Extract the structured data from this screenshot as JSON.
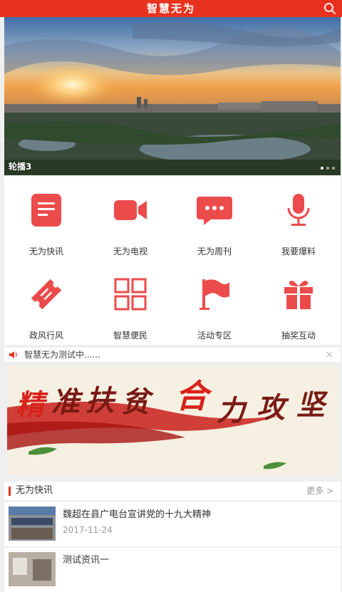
{
  "header": {
    "title": "智慧无为",
    "search_icon": "search-icon"
  },
  "banner": {
    "caption": "轮播3",
    "total_slides": 3,
    "active_slide": 1
  },
  "menu": [
    {
      "label": "无为快讯",
      "icon": "document-icon"
    },
    {
      "label": "无为电视",
      "icon": "video-camera-icon"
    },
    {
      "label": "无为周刊",
      "icon": "chat-bubble-icon"
    },
    {
      "label": "我要爆料",
      "icon": "microphone-icon"
    },
    {
      "label": "政风行风",
      "icon": "ticket-icon"
    },
    {
      "label": "智慧便民",
      "icon": "grid-icon"
    },
    {
      "label": "活动专区",
      "icon": "flag-icon"
    },
    {
      "label": "抽奖互动",
      "icon": "gift-icon"
    }
  ],
  "notice": {
    "text": "智慧无为测试中......",
    "close": "×"
  },
  "promo": {
    "slogan": [
      "精",
      "准",
      "扶",
      "贫",
      "合",
      "力",
      "攻",
      "坚"
    ]
  },
  "section": {
    "title": "无为快讯",
    "more": "更多 >"
  },
  "news": [
    {
      "title": "魏超在县广电台宣讲党的十九大精神",
      "date": "2017-11-24"
    },
    {
      "title": "测试资讯一",
      "date": ""
    }
  ],
  "colors": {
    "brand": "#e8321f",
    "icon_red": "#ec4b4b"
  }
}
